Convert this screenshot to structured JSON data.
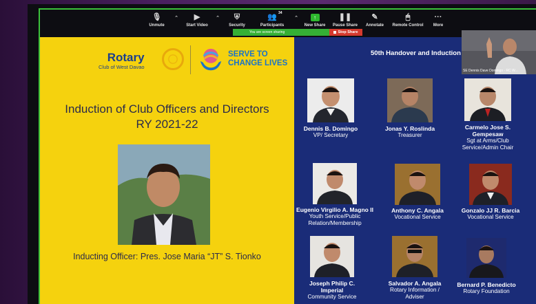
{
  "toolbar": {
    "unmute": "Unmute",
    "start_video": "Start Video",
    "security": "Security",
    "participants": "Participants",
    "participants_count": "34",
    "new_share": "New Share",
    "pause_share": "Pause Share",
    "annotate": "Annotate",
    "remote_control": "Remote Control",
    "more": "More"
  },
  "share_bar": {
    "status": "You are screen sharing",
    "stop_share": "Stop Share"
  },
  "self_view": {
    "name": "SE Dennis Dave Domingo - RC W..."
  },
  "slide": {
    "rotary": "Rotary",
    "club": "Club of West Davao",
    "serve_line1": "SERVE TO",
    "serve_line2": "CHANGE LIVES",
    "title_line1": "Induction of Club Officers and Directors",
    "title_line2": "RY 2021-22",
    "inducting": "Inducting Officer: Pres. Jose Maria “JT” S. Tionko",
    "right_title": "50th Handover and Induction o",
    "officers": [
      {
        "name": "Dennis B. Domingo",
        "role": "VP/ Secretary"
      },
      {
        "name": "Jonas Y. Roslinda",
        "role": "Treasurer"
      },
      {
        "name": "Carmelo Jose S. Gempesaw",
        "role": "Sgt at Arms/Club Service/Admin Chair"
      },
      {
        "name": "Eugenio Virgilio A. Magno II",
        "role": "Youth Service/Public Relation/Membership"
      },
      {
        "name": "Anthony C. Angala",
        "role": "Vocational Service"
      },
      {
        "name": "Gonzalo JJ R. Barcia",
        "role": "Vocational Service"
      },
      {
        "name": "Joseph Philip C. Imperial",
        "role": "Community Service"
      },
      {
        "name": "Salvador A. Angala",
        "role": "Rotary Information / Adviser"
      },
      {
        "name": "Bernard P. Benedicto",
        "role": "Rotary Foundation"
      }
    ]
  },
  "colors": {
    "slide_yellow": "#f5d20e",
    "slide_navy": "#1a2c78",
    "share_green": "#35b035",
    "stop_red": "#d53a2e"
  }
}
